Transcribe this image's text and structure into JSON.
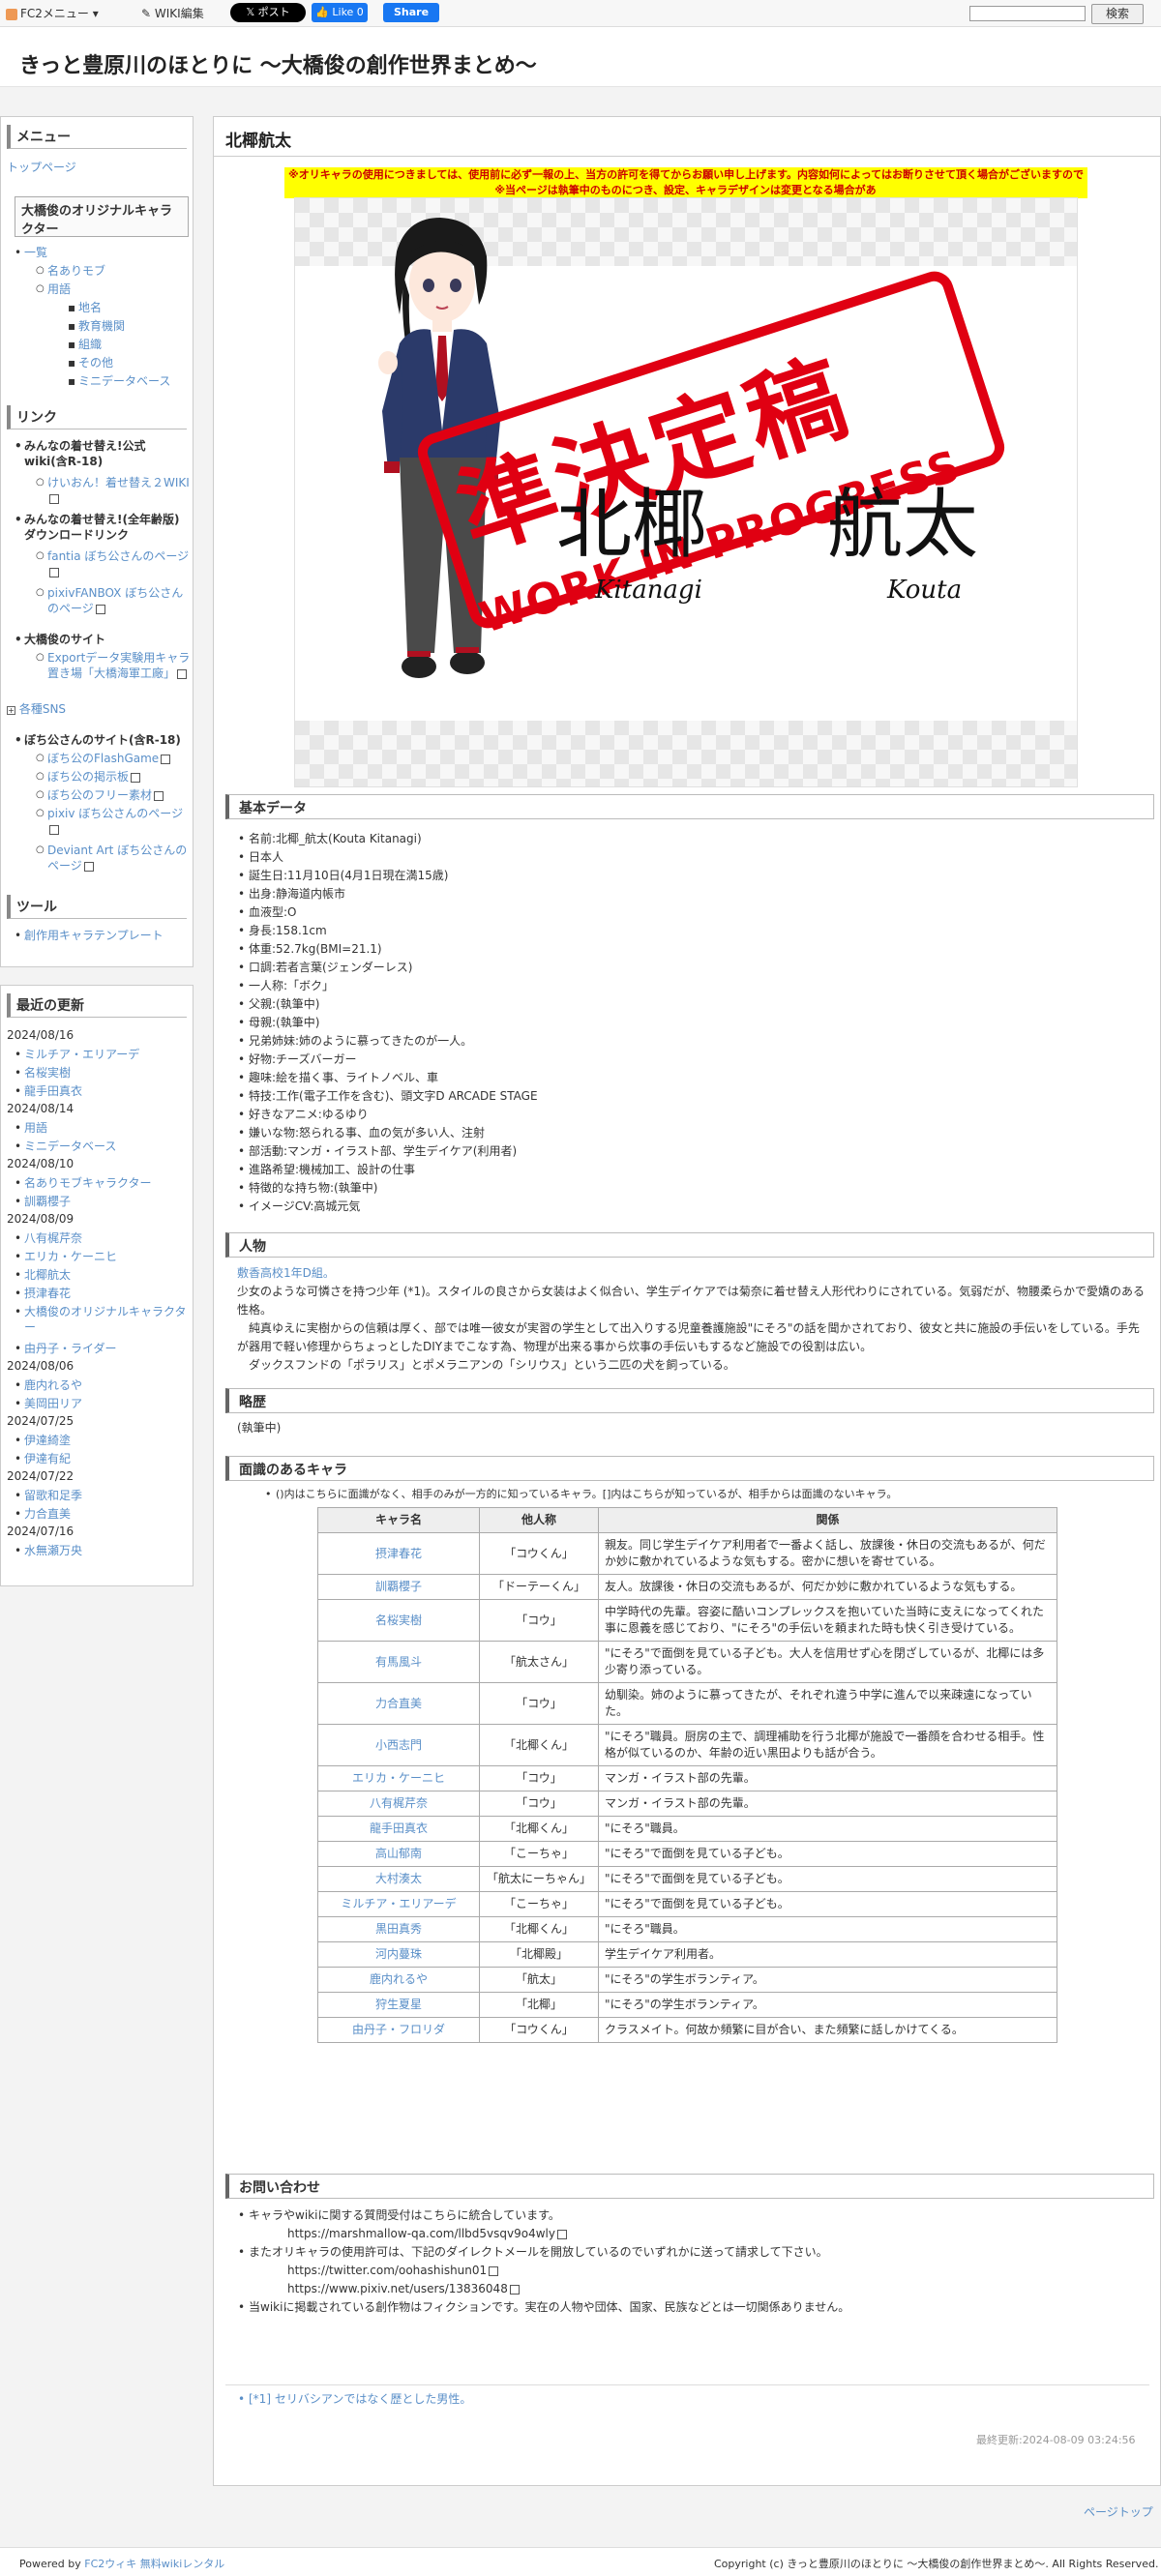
{
  "topbar": {
    "fc2_menu": "FC2メニュー ▾",
    "wiki_edit": "WIKI編集",
    "x_post": "𝕏 ポスト",
    "fb_like": "👍 Like 0",
    "fb_share": "Share",
    "search_button": "検索"
  },
  "site": {
    "title": "きっと豊原川のほとりに ～大橋俊の創作世界まとめ～"
  },
  "sidebar": {
    "menu": {
      "heading": "メニュー",
      "top_page": "トップページ",
      "original_heading": "大橋俊のオリジナルキャラクター",
      "list": "一覧",
      "named_mob": "名ありモブ",
      "terms": "用語",
      "place": "地名",
      "education": "教育機関",
      "organization": "組織",
      "other": "その他",
      "mini_db": "ミニデータベース"
    },
    "links": {
      "heading": "リンク",
      "kisekae_wiki": "みんなの着せ替え!公式wiki(含R-18)",
      "keion": "けいおん！着せ替え２WIKI",
      "kisekae_dl": "みんなの着せ替え!(全年齢版)ダウンロードリンク",
      "fantia": "fantia ぼち公さんのページ",
      "pixiv_fanbox": "pixivFANBOX ぼち公さんのページ",
      "ohashi_site": "大橋俊のサイト",
      "export_data": "Exportデータ実験用キャラ置き場「大橋海軍工廠」",
      "sns": "各種SNS",
      "bochi_site": "ぼち公さんのサイト(含R-18)",
      "bochi_flash": "ぼち公のFlashGame",
      "bochi_bbs": "ぼち公の掲示板",
      "bochi_free": "ぼち公のフリー素材",
      "pixiv_bochi": "pixiv ぼち公さんのページ",
      "deviant": "Deviant Art ぼち公さんのページ"
    },
    "tools": {
      "heading": "ツール",
      "template": "創作用キャラテンプレート"
    },
    "recent": {
      "heading": "最近の更新",
      "groups": [
        {
          "date": "2024/08/16",
          "items": [
            "ミルチア・エリアーデ",
            "名桜実樹",
            "龍手田真衣"
          ]
        },
        {
          "date": "2024/08/14",
          "items": [
            "用語",
            "ミニデータベース"
          ]
        },
        {
          "date": "2024/08/10",
          "items": [
            "名ありモブキャラクター",
            "訓覇櫻子"
          ]
        },
        {
          "date": "2024/08/09",
          "items": [
            "八有梶芹奈",
            "エリカ・ケーニヒ",
            "北椰航太",
            "摂津春花",
            "大橋俊のオリジナルキャラクター",
            "由丹子・ライダー"
          ]
        },
        {
          "date": "2024/08/06",
          "items": [
            "鹿内れるや",
            "美岡田リア"
          ]
        },
        {
          "date": "2024/07/25",
          "items": [
            "伊達綺塗",
            "伊達有紀"
          ]
        },
        {
          "date": "2024/07/22",
          "items": [
            "留歌和足季",
            "力合直美"
          ]
        },
        {
          "date": "2024/07/16",
          "items": [
            "水無瀬万央"
          ]
        }
      ]
    }
  },
  "page": {
    "title": "北椰航太",
    "notice_line1": "※オリキャラの使用につきましては、使用前に必ず一報の上、当方の許可を得てからお願い申し上げます。内容如何によってはお断りさせて頂く場合がございますのでご了承下さい。",
    "notice_line2": "※当ページは執筆中のものにつき、設定、キャラデザインは変更となる場合があります。",
    "art": {
      "stamp_kanji": "準決定稿",
      "stamp_wip": "WORK IN PROGRESS",
      "name_kanji_1": "北椰",
      "name_kanji_2": "航太",
      "name_rom_1": "Kitanagi",
      "name_rom_2": "Kouta"
    },
    "basic": {
      "heading": "基本データ",
      "items": [
        "名前:北椰_航太(Kouta Kitanagi)",
        "日本人",
        "誕生日:11月10日(4月1日現在満15歳)",
        "出身:静海道内帳市",
        "血液型:O",
        "身長:158.1cm",
        "体重:52.7kg(BMI=21.1)",
        "口調:若者言葉(ジェンダーレス)",
        "一人称:「ボク」",
        "父親:(執筆中)",
        "母親:(執筆中)",
        "兄弟姉妹:姉のように慕ってきたのが一人。",
        "好物:チーズバーガー",
        "趣味:絵を描く事、ライトノベル、車",
        "特技:工作(電子工作を含む)、頭文字D ARCADE STAGE",
        "好きなアニメ:ゆるゆり",
        "嫌いな物:怒られる事、血の気が多い人、注射",
        "部活動:マンガ・イラスト部、学生デイケア(利用者)",
        "進路希望:機械加工、設計の仕事",
        "特徴的な持ち物:(執筆中)",
        "イメージCV:高城元気"
      ]
    },
    "person": {
      "heading": "人物",
      "p1": "敷香高校1年D組。",
      "p2": "少女のような可憐さを持つ少年 (*1)。スタイルの良さから女装はよく似合い、学生デイケアでは菊奈に着せ替え人形代わりにされている。気弱だが、物腰柔らかで愛嬌のある性格。",
      "p3": "純真ゆえに実樹からの信頼は厚く、部では唯一彼女が実習の学生として出入りする児童養護施設\"にそろ\"の話を聞かされており、彼女と共に施設の手伝いをしている。手先が器用で軽い修理からちょっとしたDIYまでこなす為、物理が出来る事から炊事の手伝いもするなど施設での役割は広い。",
      "p4": "ダックスフンドの「ポラリス」とポメラニアンの「シリウス」という二匹の犬を飼っている。"
    },
    "outline": {
      "heading": "略歴",
      "text": "(執筆中)"
    },
    "relations": {
      "heading": "面識のあるキャラ",
      "note": "()内はこちらに面識がなく、相手のみが一方的に知っているキャラ。[]内はこちらが知っているが、相手からは面識のないキャラ。",
      "headers": [
        "キャラ名",
        "他人称",
        "関係"
      ],
      "rows": [
        [
          "摂津春花",
          "「コウくん」",
          "親友。同じ学生デイケア利用者で一番よく話し、放課後・休日の交流もあるが、何だか妙に敷かれているような気もする。密かに想いを寄せている。"
        ],
        [
          "訓覇櫻子",
          "「ドーテーくん」",
          "友人。放課後・休日の交流もあるが、何だか妙に敷かれているような気もする。"
        ],
        [
          "名桜実樹",
          "「コウ」",
          "中学時代の先輩。容姿に酷いコンプレックスを抱いていた当時に支えになってくれた事に恩義を感じており、\"にそろ\"の手伝いを頼まれた時も快く引き受けている。"
        ],
        [
          "有馬風斗",
          "「航太さん」",
          "\"にそろ\"で面倒を見ている子ども。大人を信用せず心を閉ざしているが、北椰には多少寄り添っている。"
        ],
        [
          "力合直美",
          "「コウ」",
          "幼馴染。姉のように慕ってきたが、それぞれ違う中学に進んで以来疎遠になっていた。"
        ],
        [
          "小西志門",
          "「北椰くん」",
          "\"にそろ\"職員。厨房の主で、調理補助を行う北椰が施設で一番顔を合わせる相手。性格が似ているのか、年齢の近い黒田よりも話が合う。"
        ],
        [
          "エリカ・ケーニヒ",
          "「コウ」",
          "マンガ・イラスト部の先輩。"
        ],
        [
          "八有梶芹奈",
          "「コウ」",
          "マンガ・イラスト部の先輩。"
        ],
        [
          "龍手田真衣",
          "「北椰くん」",
          "\"にそろ\"職員。"
        ],
        [
          "高山郁南",
          "「こーちゃ」",
          "\"にそろ\"で面倒を見ている子ども。"
        ],
        [
          "大村湊太",
          "「航太にーちゃん」",
          "\"にそろ\"で面倒を見ている子ども。"
        ],
        [
          "ミルチア・エリアーデ",
          "「こーちゃ」",
          "\"にそろ\"で面倒を見ている子ども。"
        ],
        [
          "黒田真秀",
          "「北椰くん」",
          "\"にそろ\"職員。"
        ],
        [
          "河内蔓珠",
          "「北椰殿」",
          "学生デイケア利用者。"
        ],
        [
          "鹿内れるや",
          "「航太」",
          "\"にそろ\"の学生ボランティア。"
        ],
        [
          "狩生夏星",
          "「北椰」",
          "\"にそろ\"の学生ボランティア。"
        ],
        [
          "由丹子・フロリダ",
          "「コウくん」",
          "クラスメイト。何故か頻繁に目が合い、また頻繁に話しかけてくる。"
        ]
      ]
    },
    "contact": {
      "heading": "お問い合わせ",
      "l1": "キャラやwikiに関する質問受付はこちらに統合しています。",
      "l1_url": "https://marshmallow-qa.com/llbd5vsqv9o4wly",
      "l2": "またオリキャラの使用許可は、下記のダイレクトメールを開放しているのでいずれかに送って請求して下さい。",
      "l2_url1": "https://twitter.com/oohashishun01",
      "l2_url2": "https://www.pixiv.net/users/13836048",
      "l3": "当wikiに掲載されている創作物はフィクションです。実在の人物や団体、国家、民族などとは一切関係ありません。"
    },
    "footnote": "[*1] セリバシアンではなく歴とした男性。",
    "last_updated": "最終更新:2024-08-09 03:24:56",
    "page_top": "ページトップ"
  },
  "footer": {
    "powered": "Powered by",
    "fc2wiki": "FC2ウィキ",
    "rental": "無料wikiレンタル",
    "copyright": "Copyright (c) きっと豊原川のほとりに ～大橋俊の創作世界まとめ～. All Rights Reserved."
  },
  "colors": {
    "link": "#5a8fc8",
    "stamp_red": "#e00012",
    "notice_bg": "#ffff00"
  }
}
